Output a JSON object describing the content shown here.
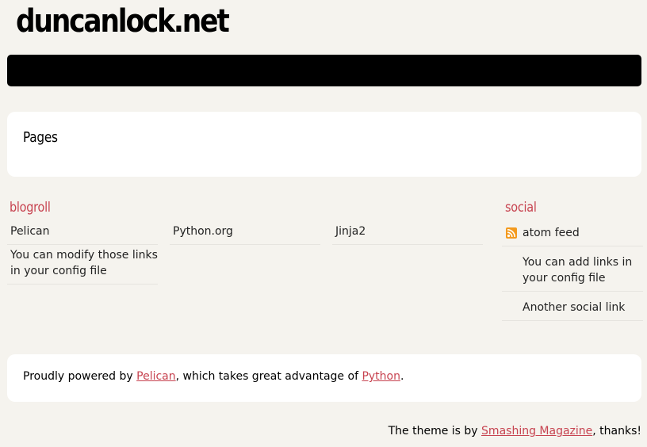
{
  "site": {
    "title": "duncanlock.net"
  },
  "pages": {
    "title": "Pages"
  },
  "blogroll": {
    "heading": "blogroll",
    "links": [
      {
        "label": "Pelican"
      },
      {
        "label": "Python.org"
      },
      {
        "label": "Jinja2"
      },
      {
        "label": "You can modify those links in your config file"
      }
    ]
  },
  "social": {
    "heading": "social",
    "links": [
      {
        "label": "atom feed",
        "icon": "rss-icon"
      },
      {
        "label": "You can add links in your config file"
      },
      {
        "label": "Another social link"
      }
    ]
  },
  "footer": {
    "prefix": "Proudly powered by ",
    "pelican_link": "Pelican",
    "middle": ", which takes great advantage of ",
    "python_link": "Python",
    "suffix": "."
  },
  "theme_credit": {
    "prefix": "The theme is by ",
    "link": "Smashing Magazine",
    "suffix": ", thanks!"
  },
  "colors": {
    "background": "#f5f3ee",
    "accent": "#c74350",
    "menu_bar": "#000000",
    "rss": "#f39a1e"
  }
}
